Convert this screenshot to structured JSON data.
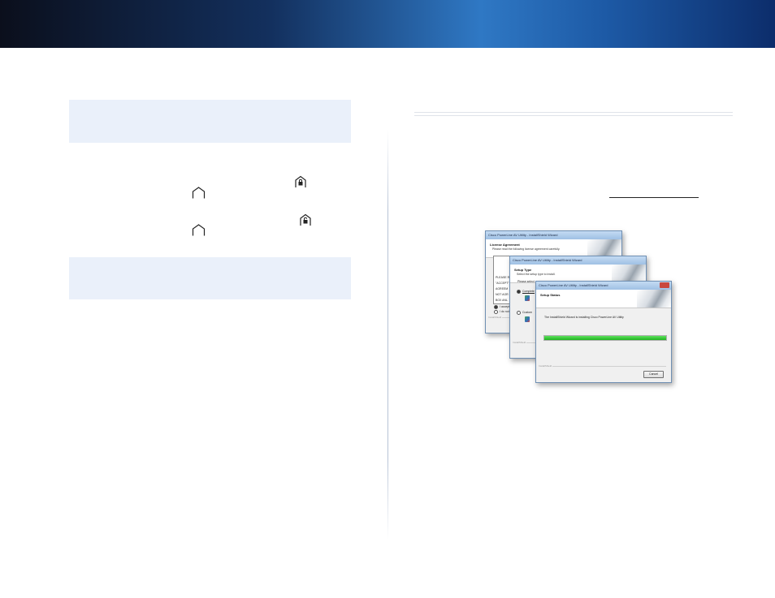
{
  "header": {
    "colors": {
      "dark": "#0b0f1c",
      "mid": "#2f78c4",
      "deep": "#0c2d6b"
    }
  },
  "left_column": {
    "note_box_color": "#eaf0fa",
    "icons": [
      "lock-house-icon",
      "house-icon",
      "unlock-house-icon",
      "house-icon"
    ]
  },
  "figure": {
    "window_license": {
      "title": "Cisco PowerLine AV Utility - InstallShield Wizard",
      "heading": "License Agreement",
      "subheading": "Please read the following license agreement carefully.",
      "body_lines": [
        "PLEASE R",
        "\"ACCEPT\" B",
        "AGREEM",
        "NOT AGR",
        "BOX ANL"
      ],
      "options": [
        "I accept",
        "I do not a"
      ],
      "footer_label": "InstallShield"
    },
    "window_setup_type": {
      "title": "Cisco PowerLine AV Utility - InstallShield Wizard",
      "heading": "Setup Type",
      "subheading": "Select the setup type to install.",
      "prompt": "Please select",
      "options": [
        "Complete",
        "Custom"
      ],
      "footer_label": "InstallShield"
    },
    "window_status": {
      "title": "Cisco PowerLine AV Utility - InstallShield Wizard",
      "heading": "Setup Status",
      "status_text": "The InstallShield Wizard is installing Cisco PowerLine AV Utility",
      "progress": 1.0,
      "progress_color": "#1fb51f",
      "cancel_label": "Cancel",
      "footer_label": "InstallShield"
    }
  }
}
